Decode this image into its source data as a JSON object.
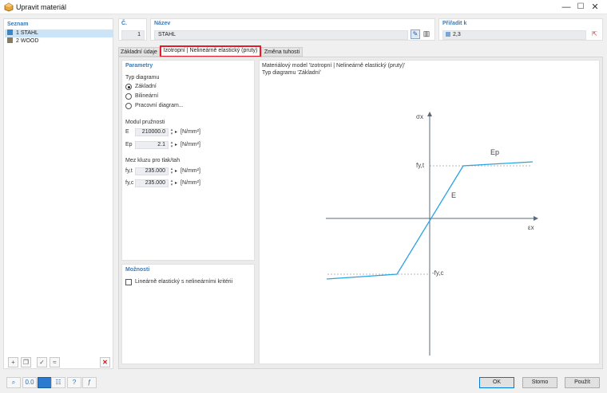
{
  "window": {
    "title": "Upravit materiál",
    "minimize": "—",
    "maximize": "☐",
    "close": "✕"
  },
  "list": {
    "heading": "Seznam",
    "items": [
      {
        "num": "1",
        "name": "STAHL",
        "color": "#3a86c8"
      },
      {
        "num": "2",
        "name": "WOOD",
        "color": "#8a7a5a"
      }
    ]
  },
  "header": {
    "number_label": "Č.",
    "number_value": "1",
    "name_label": "Název",
    "name_value": "STAHL",
    "assign_label": "Přiřadit k",
    "assign_value": "2,3"
  },
  "tabs": [
    {
      "label": "Základní údaje"
    },
    {
      "label": "Izotropní | Nelineárně elastický (pruty)"
    },
    {
      "label": "Změna tuhosti"
    }
  ],
  "params": {
    "title": "Parametry",
    "diagram_type_label": "Typ diagramu",
    "options": [
      "Základní",
      "Bilineární",
      "Pracovní diagram..."
    ],
    "selected_option": "Základní",
    "modulus_label": "Modul pružnosti",
    "E_label": "E",
    "E_value": "210000.0",
    "E_unit": "[N/mm²]",
    "Ep_label": "Ep",
    "Ep_value": "2.1",
    "Ep_unit": "[N/mm²]",
    "yield_label": "Mez kluzu pro tlak/tah",
    "fyt_label": "fy,t",
    "fyt_value": "235.000",
    "fyt_unit": "[N/mm²]",
    "fyc_label": "fy,c",
    "fyc_value": "235.000",
    "fyc_unit": "[N/mm²]"
  },
  "options_box": {
    "title": "Možnosti",
    "checkbox_label": "Lineárně elastický s nelineárními kritérii",
    "checked": false
  },
  "diagram": {
    "caption_line1": "Materiálový model 'Izotropní | Nelineárně elastický (pruty)'",
    "caption_line2": "Typ diagramu 'Základní'",
    "y_axis": "σx",
    "x_axis": "εx",
    "ep_label": "Ep",
    "e_label": "E",
    "fyt_label": "fy,t",
    "fyc_label": "-fy,c",
    "line_color": "#2aa3e0"
  },
  "footer": {
    "ok": "OK",
    "cancel": "Storno",
    "apply": "Použít"
  }
}
